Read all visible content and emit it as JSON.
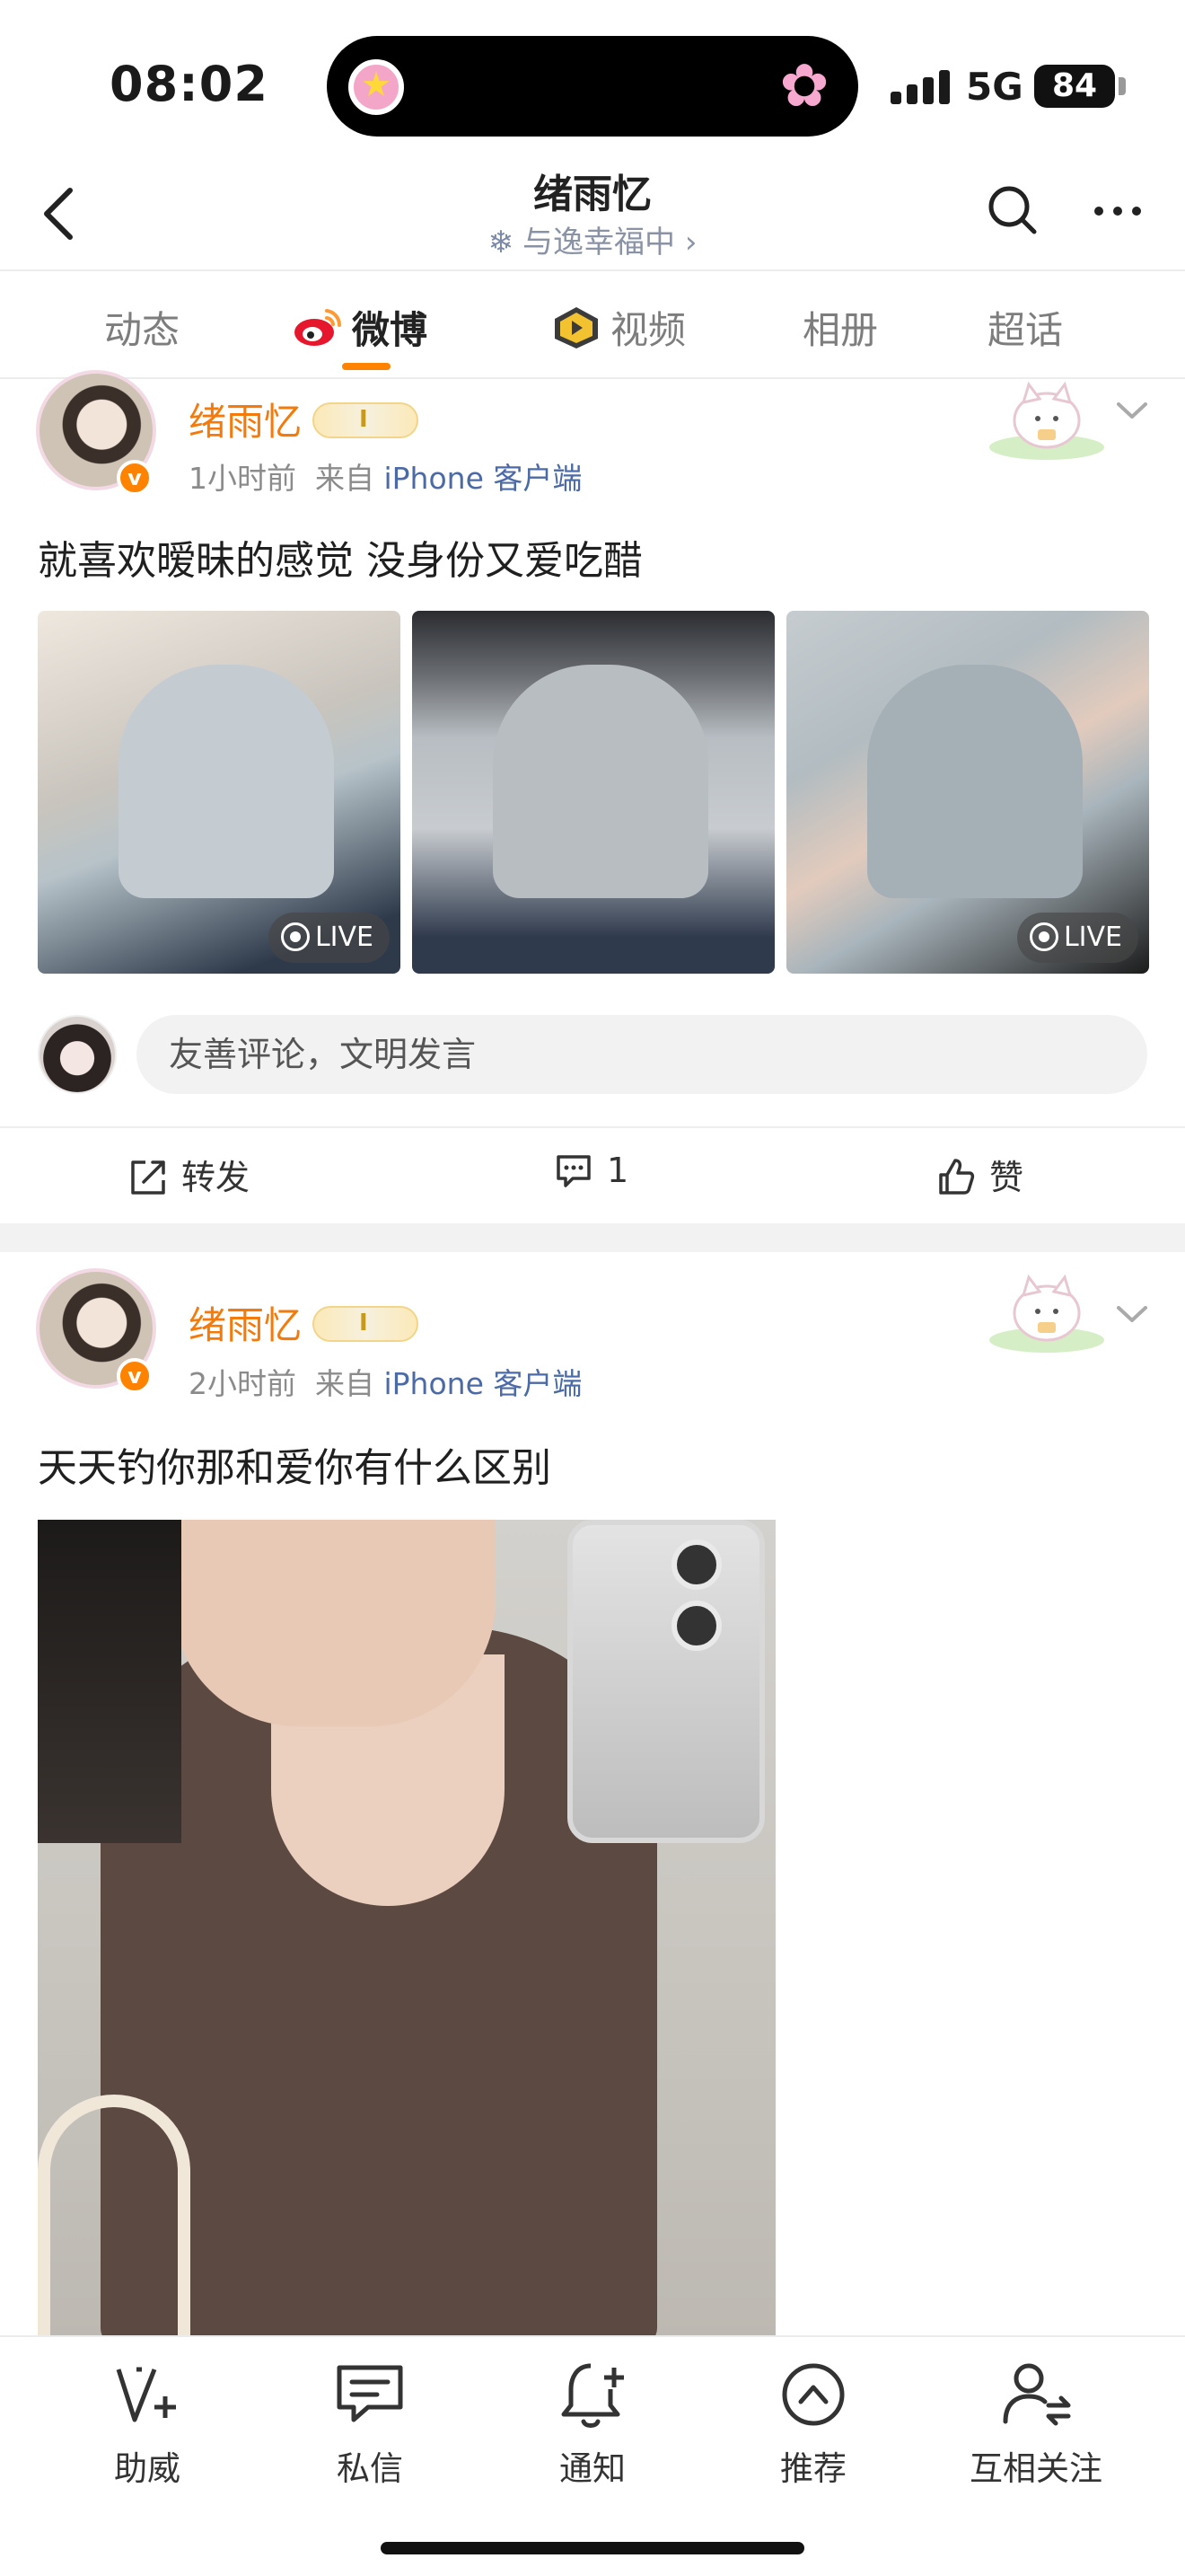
{
  "status_bar": {
    "time": "08:02",
    "network": "5G",
    "battery": "84"
  },
  "header": {
    "title": "绪雨忆",
    "subtitle": "与逸幸福中 ›",
    "subtitle_icon": "snowflake-icon"
  },
  "tabs": [
    {
      "label": "动态"
    },
    {
      "label": "微博",
      "active": true
    },
    {
      "label": "视频"
    },
    {
      "label": "相册"
    },
    {
      "label": "超话"
    }
  ],
  "posts": [
    {
      "username": "绪雨忆",
      "time": "1小时前",
      "source_prefix": "来自",
      "source": "iPhone 客户端",
      "text": "就喜欢暧昧的感觉 没身份又爱吃醋",
      "live_label": "LIVE",
      "comment_placeholder": "友善评论，文明发言",
      "actions": {
        "repost": "转发",
        "comment_count": "1",
        "like": "赞"
      }
    },
    {
      "username": "绪雨忆",
      "time": "2小时前",
      "source_prefix": "来自",
      "source": "iPhone 客户端",
      "text": "天天钓你那和爱你有什么区别"
    }
  ],
  "bottom_nav": [
    {
      "label": "助威",
      "icon": "v-plus-icon"
    },
    {
      "label": "私信",
      "icon": "message-icon"
    },
    {
      "label": "通知",
      "icon": "bell-plus-icon"
    },
    {
      "label": "推荐",
      "icon": "chevron-up-circle-icon"
    },
    {
      "label": "互相关注",
      "icon": "mutual-follow-icon"
    }
  ],
  "colors": {
    "accent": "#ff8200",
    "username": "#f47a0b",
    "source_link": "#4b6aa6"
  }
}
